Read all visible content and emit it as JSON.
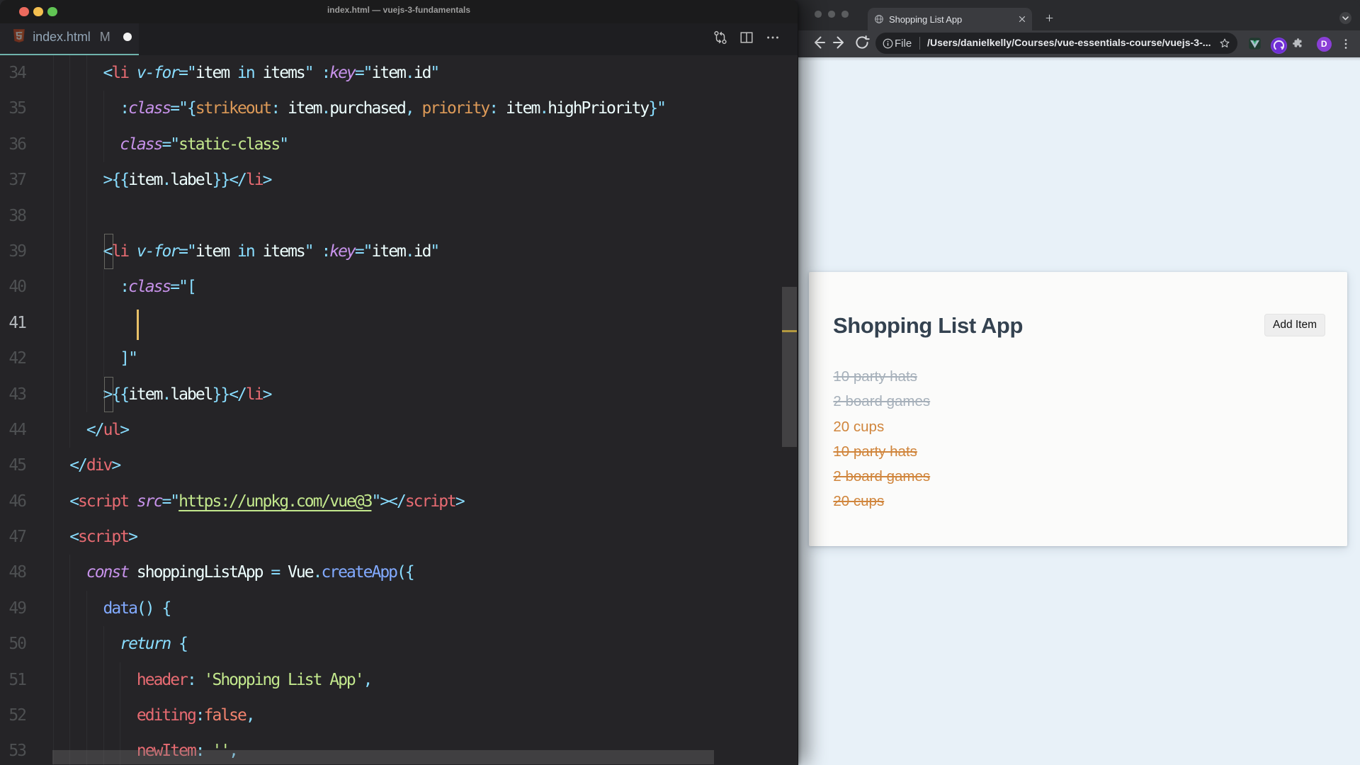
{
  "editor": {
    "window_title": "index.html — vuejs-3-fundamentals",
    "tab": {
      "filename": "index.html",
      "git_badge": "M"
    },
    "action_icons": [
      "open-changes-icon",
      "split-editor-icon",
      "more-actions-icon"
    ],
    "code": {
      "active_line": 41,
      "cursor": {
        "line": 41,
        "col": 10
      },
      "bracket_match": [
        {
          "line": 39,
          "col": 6
        },
        {
          "line": 43,
          "col": 6
        }
      ],
      "lines": [
        {
          "n": 34,
          "indent": 6,
          "guides": [
            0,
            2,
            4
          ],
          "tokens": [
            [
              "<",
              "pun"
            ],
            [
              "li",
              "tag"
            ],
            [
              " ",
              ""
            ],
            [
              "v-for",
              "dir"
            ],
            [
              "=",
              "pun"
            ],
            [
              "\"",
              "pun"
            ],
            [
              "item",
              "id"
            ],
            [
              " ",
              ""
            ],
            [
              "in",
              "op"
            ],
            [
              " ",
              ""
            ],
            [
              "items",
              "id"
            ],
            [
              "\"",
              "pun"
            ],
            [
              " ",
              ""
            ],
            [
              ":",
              "pun"
            ],
            [
              "key",
              "attr"
            ],
            [
              "=",
              "pun"
            ],
            [
              "\"",
              "pun"
            ],
            [
              "item",
              "id"
            ],
            [
              ".",
              "pun"
            ],
            [
              "id",
              "id"
            ],
            [
              "\"",
              "pun"
            ]
          ]
        },
        {
          "n": 35,
          "indent": 8,
          "guides": [
            0,
            2,
            4,
            6
          ],
          "tokens": [
            [
              ":",
              "pun"
            ],
            [
              "class",
              "attr"
            ],
            [
              "=",
              "pun"
            ],
            [
              "\"",
              "pun"
            ],
            [
              "{",
              "pun"
            ],
            [
              "strikeout",
              "okey"
            ],
            [
              ":",
              "pun"
            ],
            [
              " ",
              ""
            ],
            [
              "item",
              "id"
            ],
            [
              ".",
              "pun"
            ],
            [
              "purchased",
              "id"
            ],
            [
              ",",
              "pun"
            ],
            [
              " ",
              ""
            ],
            [
              "priority",
              "okey"
            ],
            [
              ":",
              "pun"
            ],
            [
              " ",
              ""
            ],
            [
              "item",
              "id"
            ],
            [
              ".",
              "pun"
            ],
            [
              "highPriority",
              "id"
            ],
            [
              "}",
              "pun"
            ],
            [
              "\"",
              "pun"
            ]
          ]
        },
        {
          "n": 36,
          "indent": 8,
          "guides": [
            0,
            2,
            4,
            6
          ],
          "tokens": [
            [
              "class",
              "attr"
            ],
            [
              "=",
              "pun"
            ],
            [
              "\"",
              "pun"
            ],
            [
              "static-class",
              "str"
            ],
            [
              "\"",
              "pun"
            ]
          ]
        },
        {
          "n": 37,
          "indent": 6,
          "guides": [
            0,
            2,
            4
          ],
          "tokens": [
            [
              ">",
              "pun"
            ],
            [
              "{{",
              "pun"
            ],
            [
              "item",
              "id"
            ],
            [
              ".",
              "pun"
            ],
            [
              "label",
              "id"
            ],
            [
              "}}",
              "pun"
            ],
            [
              "</",
              "pun"
            ],
            [
              "li",
              "tag"
            ],
            [
              ">",
              "pun"
            ]
          ]
        },
        {
          "n": 38,
          "indent": 0,
          "guides": [
            0,
            2,
            4
          ],
          "tokens": []
        },
        {
          "n": 39,
          "indent": 6,
          "guides": [
            0,
            2,
            4
          ],
          "tokens": [
            [
              "<",
              "pun"
            ],
            [
              "li",
              "tag"
            ],
            [
              " ",
              ""
            ],
            [
              "v-for",
              "dir"
            ],
            [
              "=",
              "pun"
            ],
            [
              "\"",
              "pun"
            ],
            [
              "item",
              "id"
            ],
            [
              " ",
              ""
            ],
            [
              "in",
              "op"
            ],
            [
              " ",
              ""
            ],
            [
              "items",
              "id"
            ],
            [
              "\"",
              "pun"
            ],
            [
              " ",
              ""
            ],
            [
              ":",
              "pun"
            ],
            [
              "key",
              "attr"
            ],
            [
              "=",
              "pun"
            ],
            [
              "\"",
              "pun"
            ],
            [
              "item",
              "id"
            ],
            [
              ".",
              "pun"
            ],
            [
              "id",
              "id"
            ],
            [
              "\"",
              "pun"
            ]
          ]
        },
        {
          "n": 40,
          "indent": 8,
          "guides": [
            0,
            2,
            4,
            6
          ],
          "tokens": [
            [
              ":",
              "pun"
            ],
            [
              "class",
              "attr"
            ],
            [
              "=",
              "pun"
            ],
            [
              "\"",
              "pun"
            ],
            [
              "[",
              "pun"
            ]
          ]
        },
        {
          "n": 41,
          "indent": 0,
          "guides": [
            0,
            2,
            4,
            6
          ],
          "tokens": []
        },
        {
          "n": 42,
          "indent": 8,
          "guides": [
            0,
            2,
            4,
            6
          ],
          "tokens": [
            [
              "]",
              "pun"
            ],
            [
              "\"",
              "pun"
            ]
          ]
        },
        {
          "n": 43,
          "indent": 6,
          "guides": [
            0,
            2,
            4
          ],
          "tokens": [
            [
              ">",
              "pun"
            ],
            [
              "{{",
              "pun"
            ],
            [
              "item",
              "id"
            ],
            [
              ".",
              "pun"
            ],
            [
              "label",
              "id"
            ],
            [
              "}}",
              "pun"
            ],
            [
              "</",
              "pun"
            ],
            [
              "li",
              "tag"
            ],
            [
              ">",
              "pun"
            ]
          ]
        },
        {
          "n": 44,
          "indent": 4,
          "guides": [
            0,
            2
          ],
          "tokens": [
            [
              "</",
              "pun"
            ],
            [
              "ul",
              "tag"
            ],
            [
              ">",
              "pun"
            ]
          ]
        },
        {
          "n": 45,
          "indent": 2,
          "guides": [
            0
          ],
          "tokens": [
            [
              "</",
              "pun"
            ],
            [
              "div",
              "tag"
            ],
            [
              ">",
              "pun"
            ]
          ]
        },
        {
          "n": 46,
          "indent": 2,
          "guides": [
            0
          ],
          "tokens": [
            [
              "<",
              "pun"
            ],
            [
              "script",
              "tag"
            ],
            [
              " ",
              ""
            ],
            [
              "src",
              "attr"
            ],
            [
              "=",
              "pun"
            ],
            [
              "\"",
              "pun"
            ],
            [
              "https://unpkg.com/vue@3",
              "lnk"
            ],
            [
              "\"",
              "pun"
            ],
            [
              ">",
              "pun"
            ],
            [
              "</",
              "pun"
            ],
            [
              "script",
              "tag"
            ],
            [
              ">",
              "pun"
            ]
          ]
        },
        {
          "n": 47,
          "indent": 2,
          "guides": [
            0
          ],
          "tokens": [
            [
              "<",
              "pun"
            ],
            [
              "script",
              "tag"
            ],
            [
              ">",
              "pun"
            ]
          ]
        },
        {
          "n": 48,
          "indent": 4,
          "guides": [
            0,
            2
          ],
          "tokens": [
            [
              "const",
              "kw"
            ],
            [
              " ",
              ""
            ],
            [
              "shoppingListApp",
              "id"
            ],
            [
              " ",
              ""
            ],
            [
              "=",
              "pun"
            ],
            [
              " ",
              ""
            ],
            [
              "Vue",
              "id"
            ],
            [
              ".",
              "pun"
            ],
            [
              "createApp",
              "fn"
            ],
            [
              "(",
              "pun"
            ],
            [
              "{",
              "pun"
            ]
          ]
        },
        {
          "n": 49,
          "indent": 6,
          "guides": [
            0,
            2,
            4
          ],
          "tokens": [
            [
              "data",
              "fn"
            ],
            [
              "(",
              "pun"
            ],
            [
              ")",
              "pun"
            ],
            [
              " ",
              ""
            ],
            [
              "{",
              "pun"
            ]
          ]
        },
        {
          "n": 50,
          "indent": 8,
          "guides": [
            0,
            2,
            4,
            6
          ],
          "tokens": [
            [
              "return",
              "kwc"
            ],
            [
              " ",
              ""
            ],
            [
              "{",
              "pun"
            ]
          ]
        },
        {
          "n": 51,
          "indent": 10,
          "guides": [
            0,
            2,
            4,
            6,
            8
          ],
          "tokens": [
            [
              "header",
              "jkey"
            ],
            [
              ":",
              "pun"
            ],
            [
              " ",
              ""
            ],
            [
              "'Shopping List App'",
              "str"
            ],
            [
              ",",
              "pun"
            ]
          ]
        },
        {
          "n": 52,
          "indent": 10,
          "guides": [
            0,
            2,
            4,
            6,
            8
          ],
          "tokens": [
            [
              "editing",
              "jkey"
            ],
            [
              ":",
              "pun"
            ],
            [
              "false",
              "bool"
            ],
            [
              ",",
              "pun"
            ]
          ]
        },
        {
          "n": 53,
          "indent": 10,
          "guides": [
            0,
            2,
            4,
            6,
            8
          ],
          "tokens": [
            [
              "newItem",
              "jkey"
            ],
            [
              ":",
              "pun"
            ],
            [
              " ",
              ""
            ],
            [
              "''",
              "str"
            ],
            [
              ",",
              "pun"
            ]
          ]
        }
      ]
    }
  },
  "browser": {
    "tab_title": "Shopping List App",
    "address": {
      "prefix": "File",
      "url": "/Users/danielkelly/Courses/vue-essentials-course/vuejs-3-..."
    },
    "toolbar_icons": [
      "back-icon",
      "forward-icon",
      "reload-icon",
      "info-icon",
      "bookmark-star-icon",
      "vue-extension-icon",
      "purple-extension-icon",
      "extensions-puzzle-icon",
      "profile-avatar",
      "menu-dots-icon"
    ],
    "profile_initial": "D",
    "page": {
      "heading": "Shopping List App",
      "add_button": "Add Item",
      "items": [
        {
          "label": "10 party hats",
          "classes": "strikeout"
        },
        {
          "label": "2 board games",
          "classes": "strikeout"
        },
        {
          "label": "20 cups",
          "classes": "priority"
        },
        {
          "label": "10 party hats",
          "classes": "strikeout priority"
        },
        {
          "label": "2 board games",
          "classes": "strikeout priority"
        },
        {
          "label": "20 cups",
          "classes": "strikeout priority"
        }
      ]
    }
  }
}
